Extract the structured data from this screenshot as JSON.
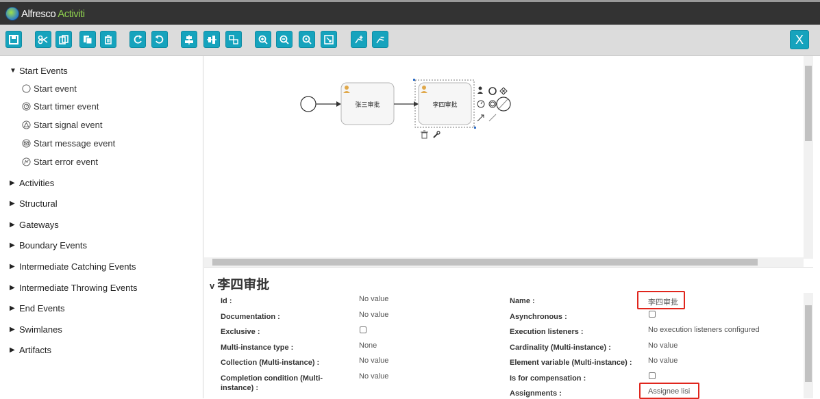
{
  "app": {
    "brand": "Alfresco",
    "product": "Activiti"
  },
  "toolbar": {
    "close_label": "X"
  },
  "palette": {
    "groups": [
      {
        "label": "Start Events",
        "expanded": true
      },
      {
        "label": "Activities"
      },
      {
        "label": "Structural"
      },
      {
        "label": "Gateways"
      },
      {
        "label": "Boundary Events"
      },
      {
        "label": "Intermediate Catching Events"
      },
      {
        "label": "Intermediate Throwing Events"
      },
      {
        "label": "End Events"
      },
      {
        "label": "Swimlanes"
      },
      {
        "label": "Artifacts"
      }
    ],
    "start_items": [
      {
        "label": "Start event",
        "icon": "circle-icon"
      },
      {
        "label": "Start timer event",
        "icon": "timer-icon"
      },
      {
        "label": "Start signal event",
        "icon": "signal-icon"
      },
      {
        "label": "Start message event",
        "icon": "message-icon"
      },
      {
        "label": "Start error event",
        "icon": "error-icon"
      }
    ]
  },
  "diagram": {
    "task1": "张三审批",
    "task2": "李四审批"
  },
  "properties": {
    "title": "李四审批",
    "left": [
      {
        "label": "Id :",
        "value": "No value"
      },
      {
        "label": "Documentation :",
        "value": "No value"
      },
      {
        "label": "Exclusive :",
        "value": ""
      },
      {
        "label": "Multi-instance type :",
        "value": "None"
      },
      {
        "label": "Collection (Multi-instance) :",
        "value": "No value"
      },
      {
        "label": "Completion condition (Multi-instance) :",
        "value": "No value"
      }
    ],
    "right": [
      {
        "label": "Name :",
        "value": "李四审批"
      },
      {
        "label": "Asynchronous :",
        "value": ""
      },
      {
        "label": "Execution listeners :",
        "value": "No execution listeners configured"
      },
      {
        "label": "Cardinality (Multi-instance) :",
        "value": "No value"
      },
      {
        "label": "Element variable (Multi-instance) :",
        "value": "No value"
      },
      {
        "label": "Is for compensation :",
        "value": ""
      },
      {
        "label": "Assignments :",
        "value": "Assignee lisi"
      }
    ]
  },
  "colors": {
    "accent": "#16a3bd",
    "titlebar": "#333333",
    "highlight": "#e0261d"
  }
}
